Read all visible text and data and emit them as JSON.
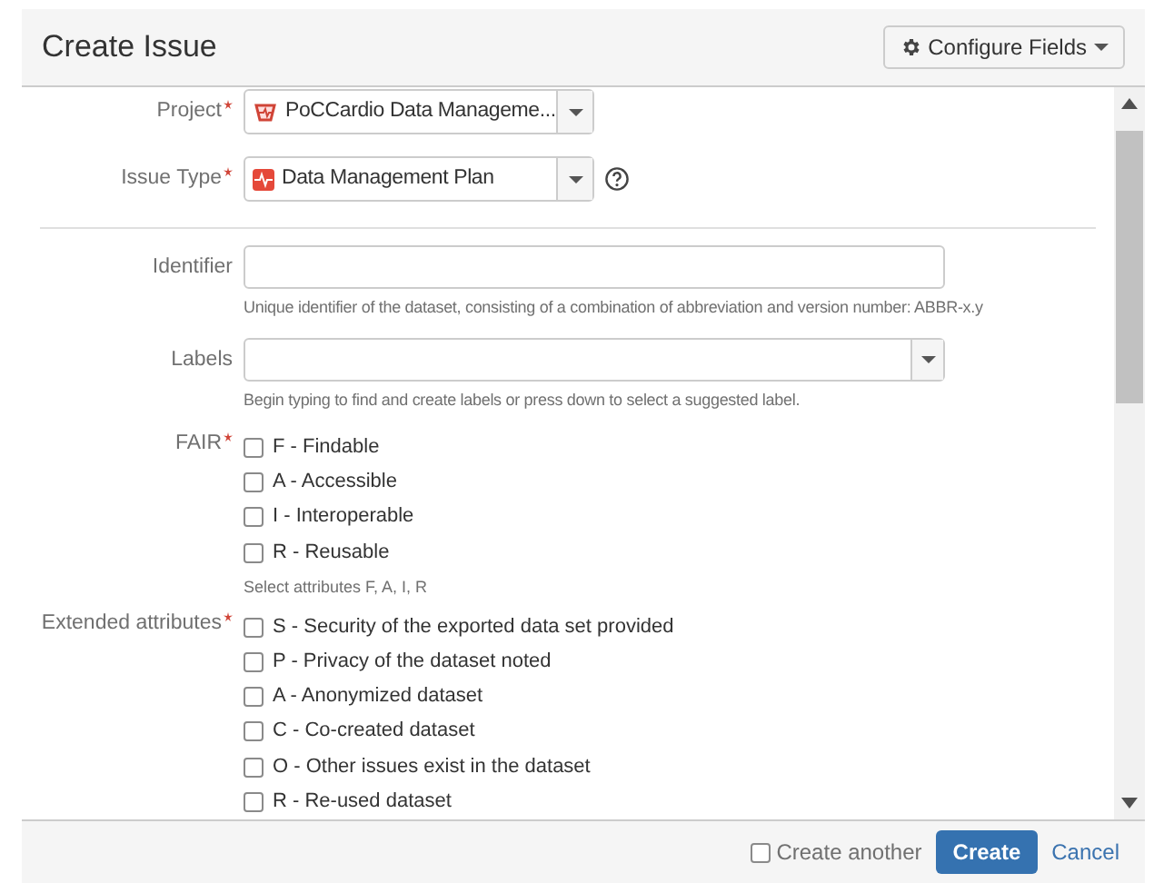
{
  "dialog": {
    "title": "Create Issue",
    "configure_button": "Configure Fields"
  },
  "fields": [
    {
      "kind": "select",
      "label": "Project",
      "required": true,
      "value": "PoCCardio Data Manageme...",
      "help_icon": false
    },
    {
      "kind": "select",
      "label": "Issue Type",
      "required": true,
      "value": "Data Management Plan",
      "help_icon": true
    },
    {
      "kind": "divider"
    },
    {
      "kind": "input",
      "label": "Identifier",
      "required": false,
      "hint": "Unique identifier of the dataset, consisting of a combination of abbreviation and version number: ABBR-x.y"
    },
    {
      "kind": "labels",
      "label": "Labels",
      "required": false,
      "hint": "Begin typing to find and create labels or press down to select a suggested label."
    },
    {
      "kind": "checkboxes",
      "label": "FAIR",
      "required": true,
      "options": [
        {
          "label": "F - Findable",
          "checked": false
        },
        {
          "label": "A - Accessible",
          "checked": false
        },
        {
          "label": "I - Interoperable",
          "checked": false
        },
        {
          "label": "R - Reusable",
          "checked": false
        }
      ],
      "hint": "Select attributes F, A, I, R"
    },
    {
      "kind": "checkboxes",
      "label": "Extended attributes",
      "required": true,
      "options": [
        {
          "label": "S - Security of the exported data set provided",
          "checked": false
        },
        {
          "label": "P - Privacy of the dataset noted",
          "checked": false
        },
        {
          "label": "A - Anonymized dataset",
          "checked": false
        },
        {
          "label": "C - Co-created dataset",
          "checked": false
        },
        {
          "label": "O - Other issues exist in the dataset",
          "checked": false
        },
        {
          "label": "R - Re-used dataset",
          "checked": false
        }
      ]
    }
  ],
  "footer": {
    "create_another": {
      "label": "Create another",
      "checked": false
    },
    "create_button": "Create",
    "cancel_link": "Cancel"
  }
}
